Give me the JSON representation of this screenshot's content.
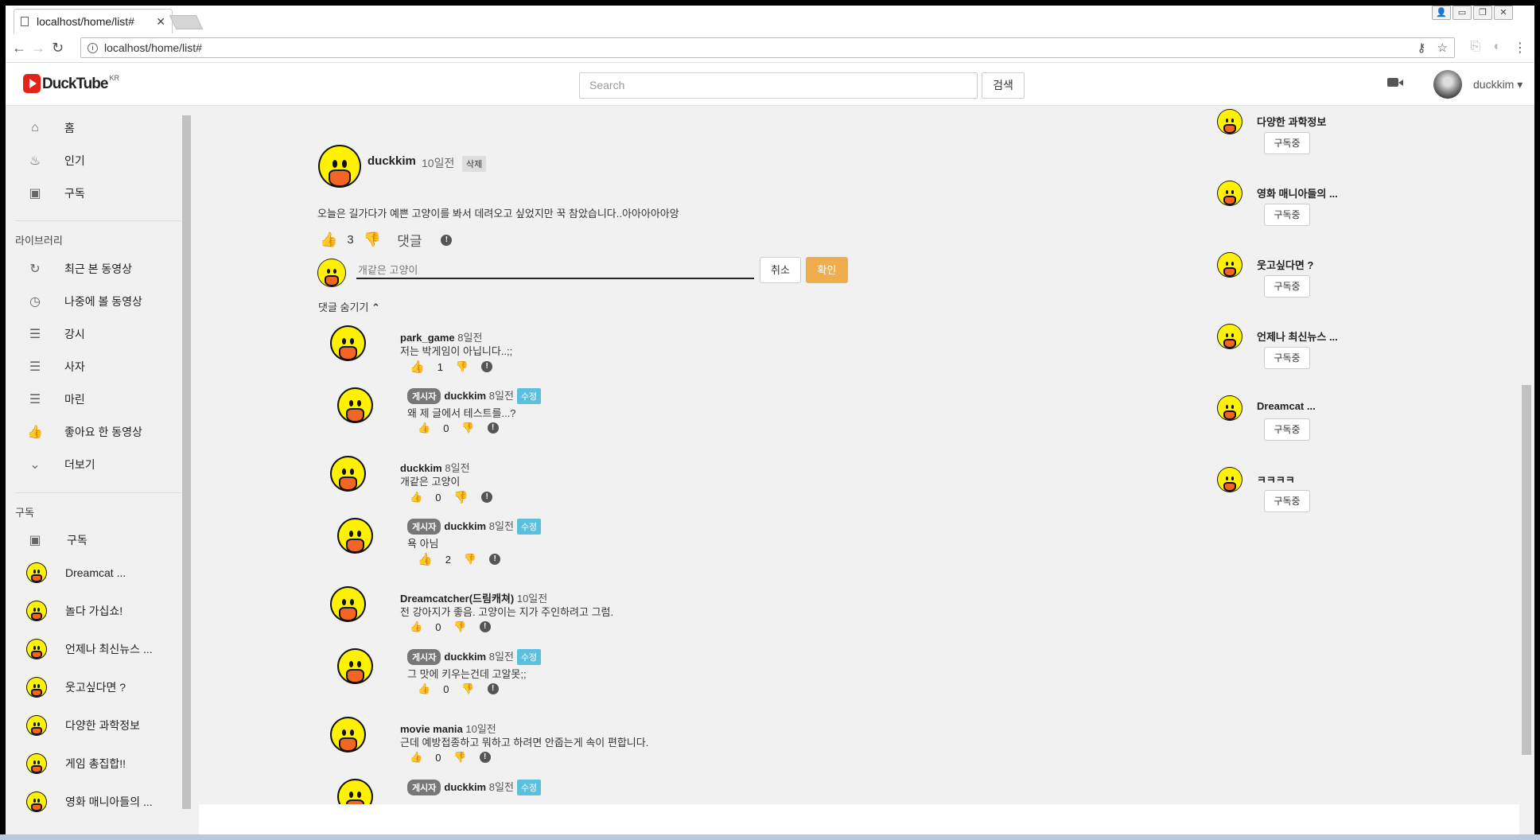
{
  "browser": {
    "tab_title": "localhost/home/list#",
    "url": "localhost/home/list#"
  },
  "header": {
    "logo": "DuckTube",
    "logo_suffix": "KR",
    "search_placeholder": "Search",
    "search_button": "검색",
    "username": "duckkim"
  },
  "sidebar": {
    "main": [
      {
        "icon": "home-icon",
        "label": "홈"
      },
      {
        "icon": "fire-icon",
        "label": "인기"
      },
      {
        "icon": "inbox-icon",
        "label": "구독"
      }
    ],
    "library_heading": "라이브러리",
    "library": [
      {
        "icon": "refresh-icon",
        "label": "최근 본 동영상"
      },
      {
        "icon": "clock-icon",
        "label": "나중에 볼 동영상"
      },
      {
        "icon": "list-icon",
        "label": "강시"
      },
      {
        "icon": "list-icon",
        "label": "사자"
      },
      {
        "icon": "list-icon",
        "label": "마린"
      },
      {
        "icon": "thumbs-up-icon",
        "label": "좋아요 한 동영상"
      },
      {
        "icon": "chevron-down-icon",
        "label": "더보기"
      }
    ],
    "subs_heading": "구독",
    "subs_all": "구독",
    "subs": [
      "Dreamcat ...",
      "놀다 가십쇼!",
      "언제나 최신뉴스 ...",
      "웃고싶다면 ?",
      "다양한 과학정보",
      "게임 총집합!!",
      "영화 매니아들의 ..."
    ]
  },
  "post": {
    "author": "duckkim",
    "time": "10일전",
    "delete_label": "삭제",
    "text": "오늘은 길가다가 예쁜 고양이를 봐서 데려오고 싶었지만 꾹 참았습니다..아아아아아앙",
    "likes": "3",
    "comment_label": "댓글"
  },
  "comment_input": {
    "value": "개같은 고양이",
    "cancel": "취소",
    "confirm": "확인"
  },
  "hide_comments": "댓글 숨기기",
  "comments": [
    {
      "author": "park_game",
      "time": "8일전",
      "text": "저는 박게임이 아닙니다..;;",
      "likes": "1",
      "reply": {
        "badge": "게시자",
        "author": "duckkim",
        "time": "8일전",
        "edit": "수정",
        "text": "왜 제 글에서 테스트를...?",
        "likes": "0"
      }
    },
    {
      "author": "duckkim",
      "time": "8일전",
      "text": "개같은 고양이",
      "likes": "0",
      "reply": {
        "badge": "게시자",
        "author": "duckkim",
        "time": "8일전",
        "edit": "수정",
        "text": "욕 아님",
        "likes": "2"
      }
    },
    {
      "author": "Dreamcatcher(드림캐쳐)",
      "time": "10일전",
      "text": "전 강아지가 좋음. 고양이는 지가 주인하려고 그럼.",
      "likes": "0",
      "reply": {
        "badge": "게시자",
        "author": "duckkim",
        "time": "8일전",
        "edit": "수정",
        "text": "그 맛에 키우는건데 고알못;;",
        "likes": "0"
      }
    },
    {
      "author": "movie mania",
      "time": "10일전",
      "text": "근데 예방접종하고 뭐하고 하려면 안줍는게 속이 편합니다.",
      "likes": "0",
      "reply": {
        "badge": "게시자",
        "author": "duckkim",
        "time": "8일전",
        "edit": "수정",
        "text": "",
        "likes": ""
      }
    }
  ],
  "right_subs": [
    {
      "name": "다양한 과학정보",
      "button": "구독중"
    },
    {
      "name": "영화 매니아들의 ...",
      "button": "구독중"
    },
    {
      "name": "웃고싶다면 ?",
      "button": "구독중"
    },
    {
      "name": "언제나 최신뉴스 ...",
      "button": "구독중"
    },
    {
      "name": "Dreamcat ...",
      "button": "구독중"
    },
    {
      "name": "ㅋㅋㅋㅋ",
      "button": "구독중"
    }
  ]
}
